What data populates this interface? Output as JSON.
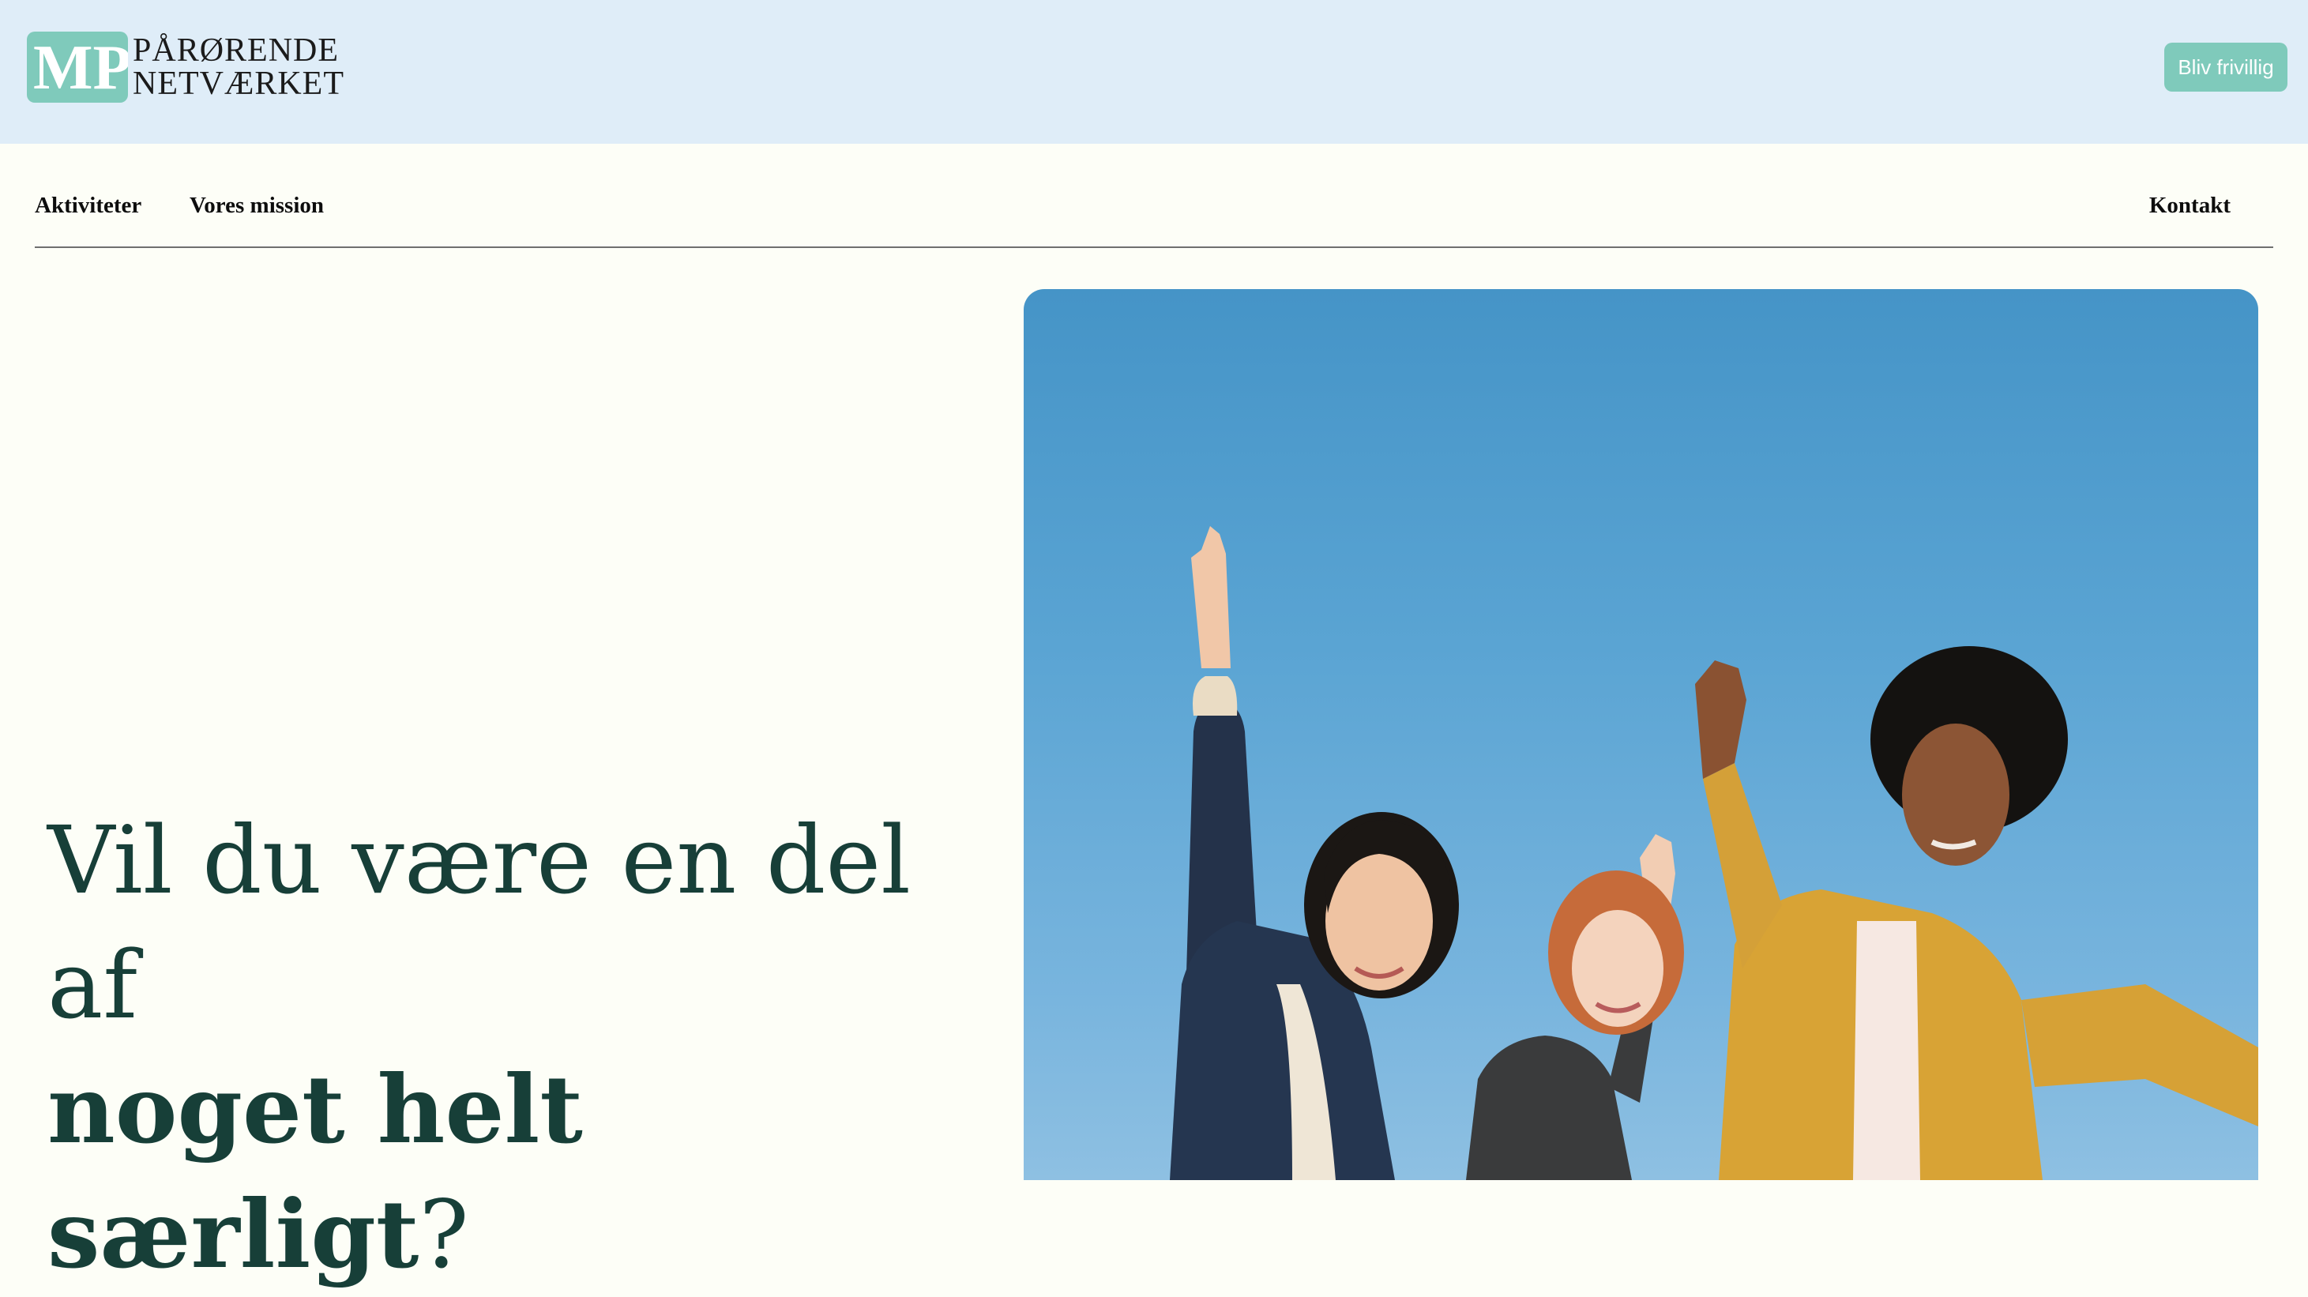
{
  "header": {
    "logo": {
      "mark": "MP",
      "line1": "PÅRØRENDE",
      "line2": "NETVÆRKET"
    },
    "volunteer_button": "Bliv frivillig"
  },
  "nav": {
    "items": [
      "Aktiviteter",
      "Vores mission"
    ],
    "contact": "Kontakt"
  },
  "hero": {
    "heading_line1": "Vil du være en del af",
    "heading_bold": "noget helt særligt",
    "heading_end": "?",
    "image": "photo-three-young-people-raising-hands-blue-sky"
  },
  "colors": {
    "header_bg": "#dfedf8",
    "page_bg": "#fdfef7",
    "accent": "#7fcabb",
    "heading": "#173f38",
    "sky": "#5aa4d3"
  }
}
